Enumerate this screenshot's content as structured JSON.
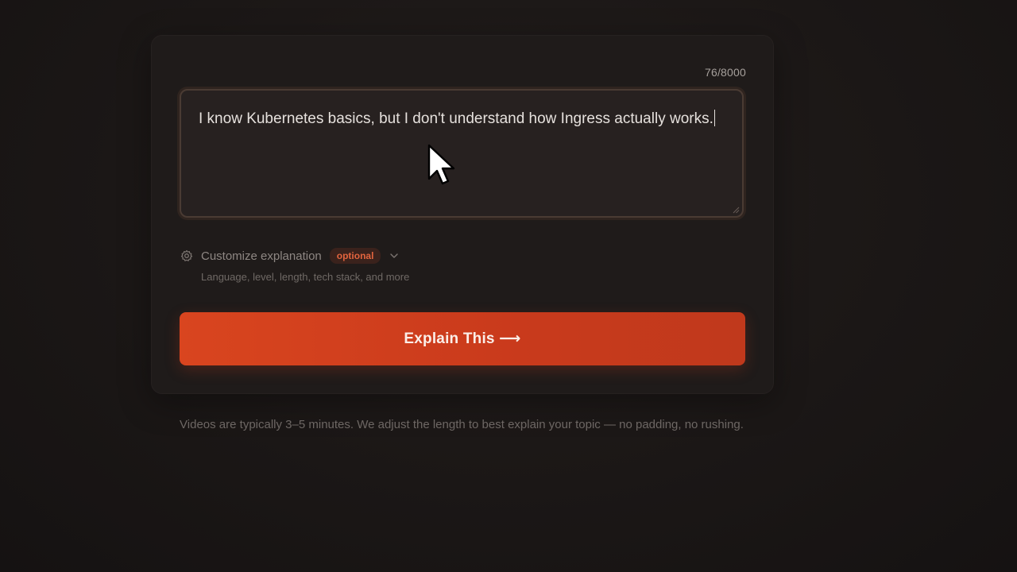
{
  "composer": {
    "char_count": "76/8000",
    "prompt_text": "I know Kubernetes basics, but I don't understand how Ingress actually works."
  },
  "customize": {
    "icon": "gear-icon",
    "label": "Customize explanation",
    "badge": "optional",
    "chevron_icon": "chevron-down-icon",
    "subtitle": "Language, level, length, tech stack, and more"
  },
  "action": {
    "explain_label": "Explain This ⟶"
  },
  "footer": {
    "note": "Videos are typically 3–5 minutes. We adjust the length to best explain your topic — no padding, no rushing."
  },
  "colors": {
    "accent": "#d9451f",
    "badge_text": "#e2643e",
    "background": "#1a1616"
  }
}
